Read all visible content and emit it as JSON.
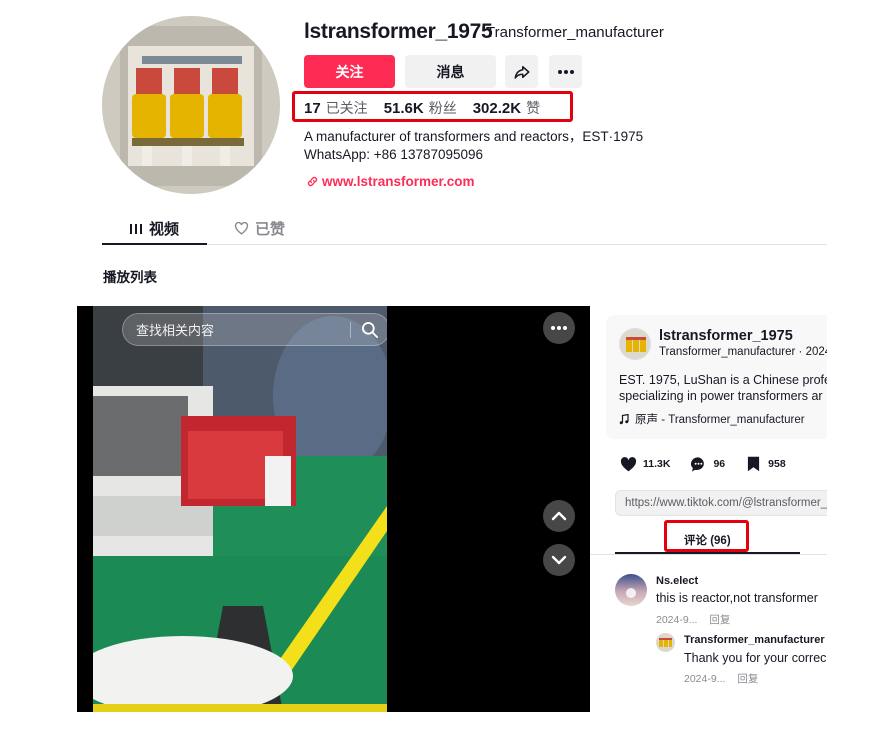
{
  "profile": {
    "handle": "lstransformer_1975",
    "nickname": "Transformer_manufacturer",
    "follow_label": "关注",
    "message_label": "消息",
    "stats": {
      "following_count": "17",
      "following_label": "已关注",
      "followers_count": "51.6K",
      "followers_label": "粉丝",
      "likes_count": "302.2K",
      "likes_label": "赞"
    },
    "bio_line1": "A manufacturer of transformers and reactors，EST·1975",
    "bio_line2": "WhatsApp: +86 13787095096",
    "website": "www.lstransformer.com"
  },
  "tabs": {
    "videos": "视频",
    "liked": "已赞"
  },
  "playlist_label": "播放列表",
  "player": {
    "search_placeholder": "查找相关内容"
  },
  "panel": {
    "username": "lstransformer_1975",
    "subline": "Transformer_manufacturer · 2024",
    "desc_line1": "EST. 1975, LuShan is a Chinese profe",
    "desc_line2": "specializing in power transformers ar",
    "music": "原声 - Transformer_manufacturer",
    "likes": "11.3K",
    "comments": "96",
    "saves": "958",
    "url": "https://www.tiktok.com/@lstransformer_",
    "comments_tab": "评论 (96)"
  },
  "comments": [
    {
      "user": "Ns.elect",
      "text": "this is reactor,not transformer",
      "date": "2024-9...",
      "reply_label": "回复",
      "reply": {
        "user": "Transformer_manufacturer ·",
        "text": "Thank you for your correc",
        "date": "2024-9...",
        "reply_label": "回复"
      }
    }
  ],
  "colors": {
    "accent": "#fe2c55",
    "highlight_box": "#e3000f",
    "text": "#161823",
    "muted": "#8a8b91"
  },
  "icons": [
    "share-icon",
    "more-icon",
    "link-icon",
    "grid-icon",
    "heart-outline-icon",
    "search-icon",
    "more-dots-icon",
    "chevron-up-icon",
    "chevron-down-icon",
    "music-note-icon",
    "heart-icon",
    "comment-icon",
    "bookmark-icon"
  ]
}
